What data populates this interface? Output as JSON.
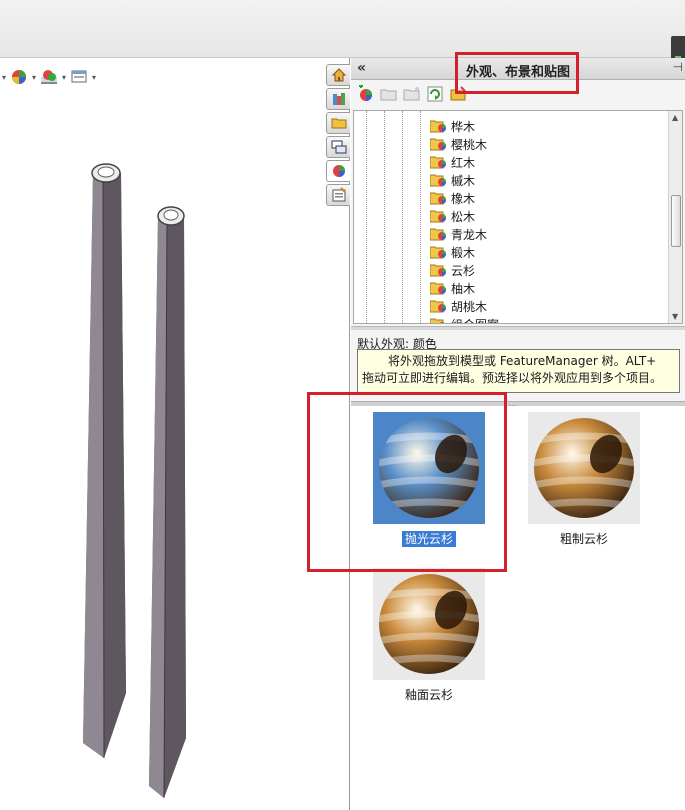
{
  "panel": {
    "collapse_glyph": "«",
    "title": "外观、布景和贴图",
    "pin_glyph": "⊣",
    "toolbar_icons": [
      "add-appearance-icon",
      "open-folder-icon",
      "new-folder-icon",
      "refresh-icon",
      "save-icon"
    ]
  },
  "task_tabs": [
    "home-icon",
    "design-library-icon",
    "file-explorer-icon",
    "view-palette-icon",
    "appearances-icon",
    "custom-properties-icon"
  ],
  "view_toolbar_icons": [
    "display-style-icon",
    "appearance-icon",
    "scene-icon",
    "view-settings-icon"
  ],
  "tree": {
    "items": [
      "桦木",
      "樱桃木",
      "红木",
      "槭木",
      "橡木",
      "松木",
      "青龙木",
      "椴木",
      "云杉",
      "柚木",
      "胡桃木",
      "组合图案"
    ]
  },
  "default_appearance": "默认外观: 颜色",
  "tooltip": {
    "line1": "将外观拖放到模型或 FeatureManager 树。ALT+",
    "line2": "拖动可立即进行编辑。预选择以将外观应用到多个项目。"
  },
  "gallery": {
    "items": [
      {
        "label": "抛光云杉",
        "selected": true,
        "color": "#5a8fc8"
      },
      {
        "label": "粗制云杉",
        "selected": false,
        "color": "#c88a3c"
      },
      {
        "label": "釉面云杉",
        "selected": false,
        "color": "#c98a3a"
      }
    ]
  },
  "colors": {
    "highlight": "#d4202a",
    "tooltip_bg": "#ffffe1",
    "selection": "#3a7bd5",
    "model": "#6e6670"
  }
}
